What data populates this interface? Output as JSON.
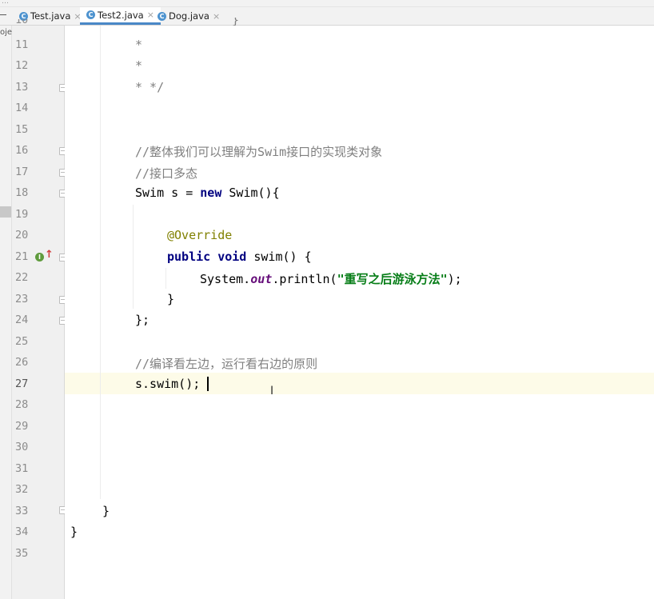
{
  "tabs": [
    {
      "label": "Test.java",
      "close": "×"
    },
    {
      "label": "Test2.java",
      "close": "×"
    },
    {
      "label": "Dog.java",
      "close": "×"
    }
  ],
  "project_label": "oje",
  "breadcrumb_fragment": "…",
  "tab_icon_letter": "C",
  "impl_icon_letter": "I",
  "line_numbers": [
    "10",
    "11",
    "12",
    "13",
    "14",
    "15",
    "16",
    "17",
    "18",
    "19",
    "20",
    "21",
    "22",
    "23",
    "24",
    "25",
    "26",
    "27",
    "28",
    "29",
    "30",
    "31",
    "32",
    "33",
    "34",
    "35"
  ],
  "code": {
    "l10": "}",
    "l11": "*",
    "l12": "*",
    "l13": "* */",
    "l16": "//整体我们可以理解为Swim接口的实现类对象",
    "l17": "//接口多态",
    "l18_type": "Swim s = ",
    "l18_new": "new",
    "l18_rest": " Swim(){",
    "l20": "@Override",
    "l21_kw": "public void",
    "l21_rest": " swim() {",
    "l22_a": "System.",
    "l22_field": "out",
    "l22_b": ".println(",
    "l22_str": "\"重写之后游泳方法\"",
    "l22_c": ");",
    "l23": "}",
    "l24": "};",
    "l26": "//编译看左边，运行看右边的原则",
    "l27": "s.swim();",
    "l33": "}",
    "l34": "}"
  },
  "colors": {
    "keyword": "#000080",
    "comment": "#808080",
    "annotation": "#808000",
    "string": "#067d17",
    "field": "#660e7a",
    "current_line": "#fdfbe8"
  }
}
